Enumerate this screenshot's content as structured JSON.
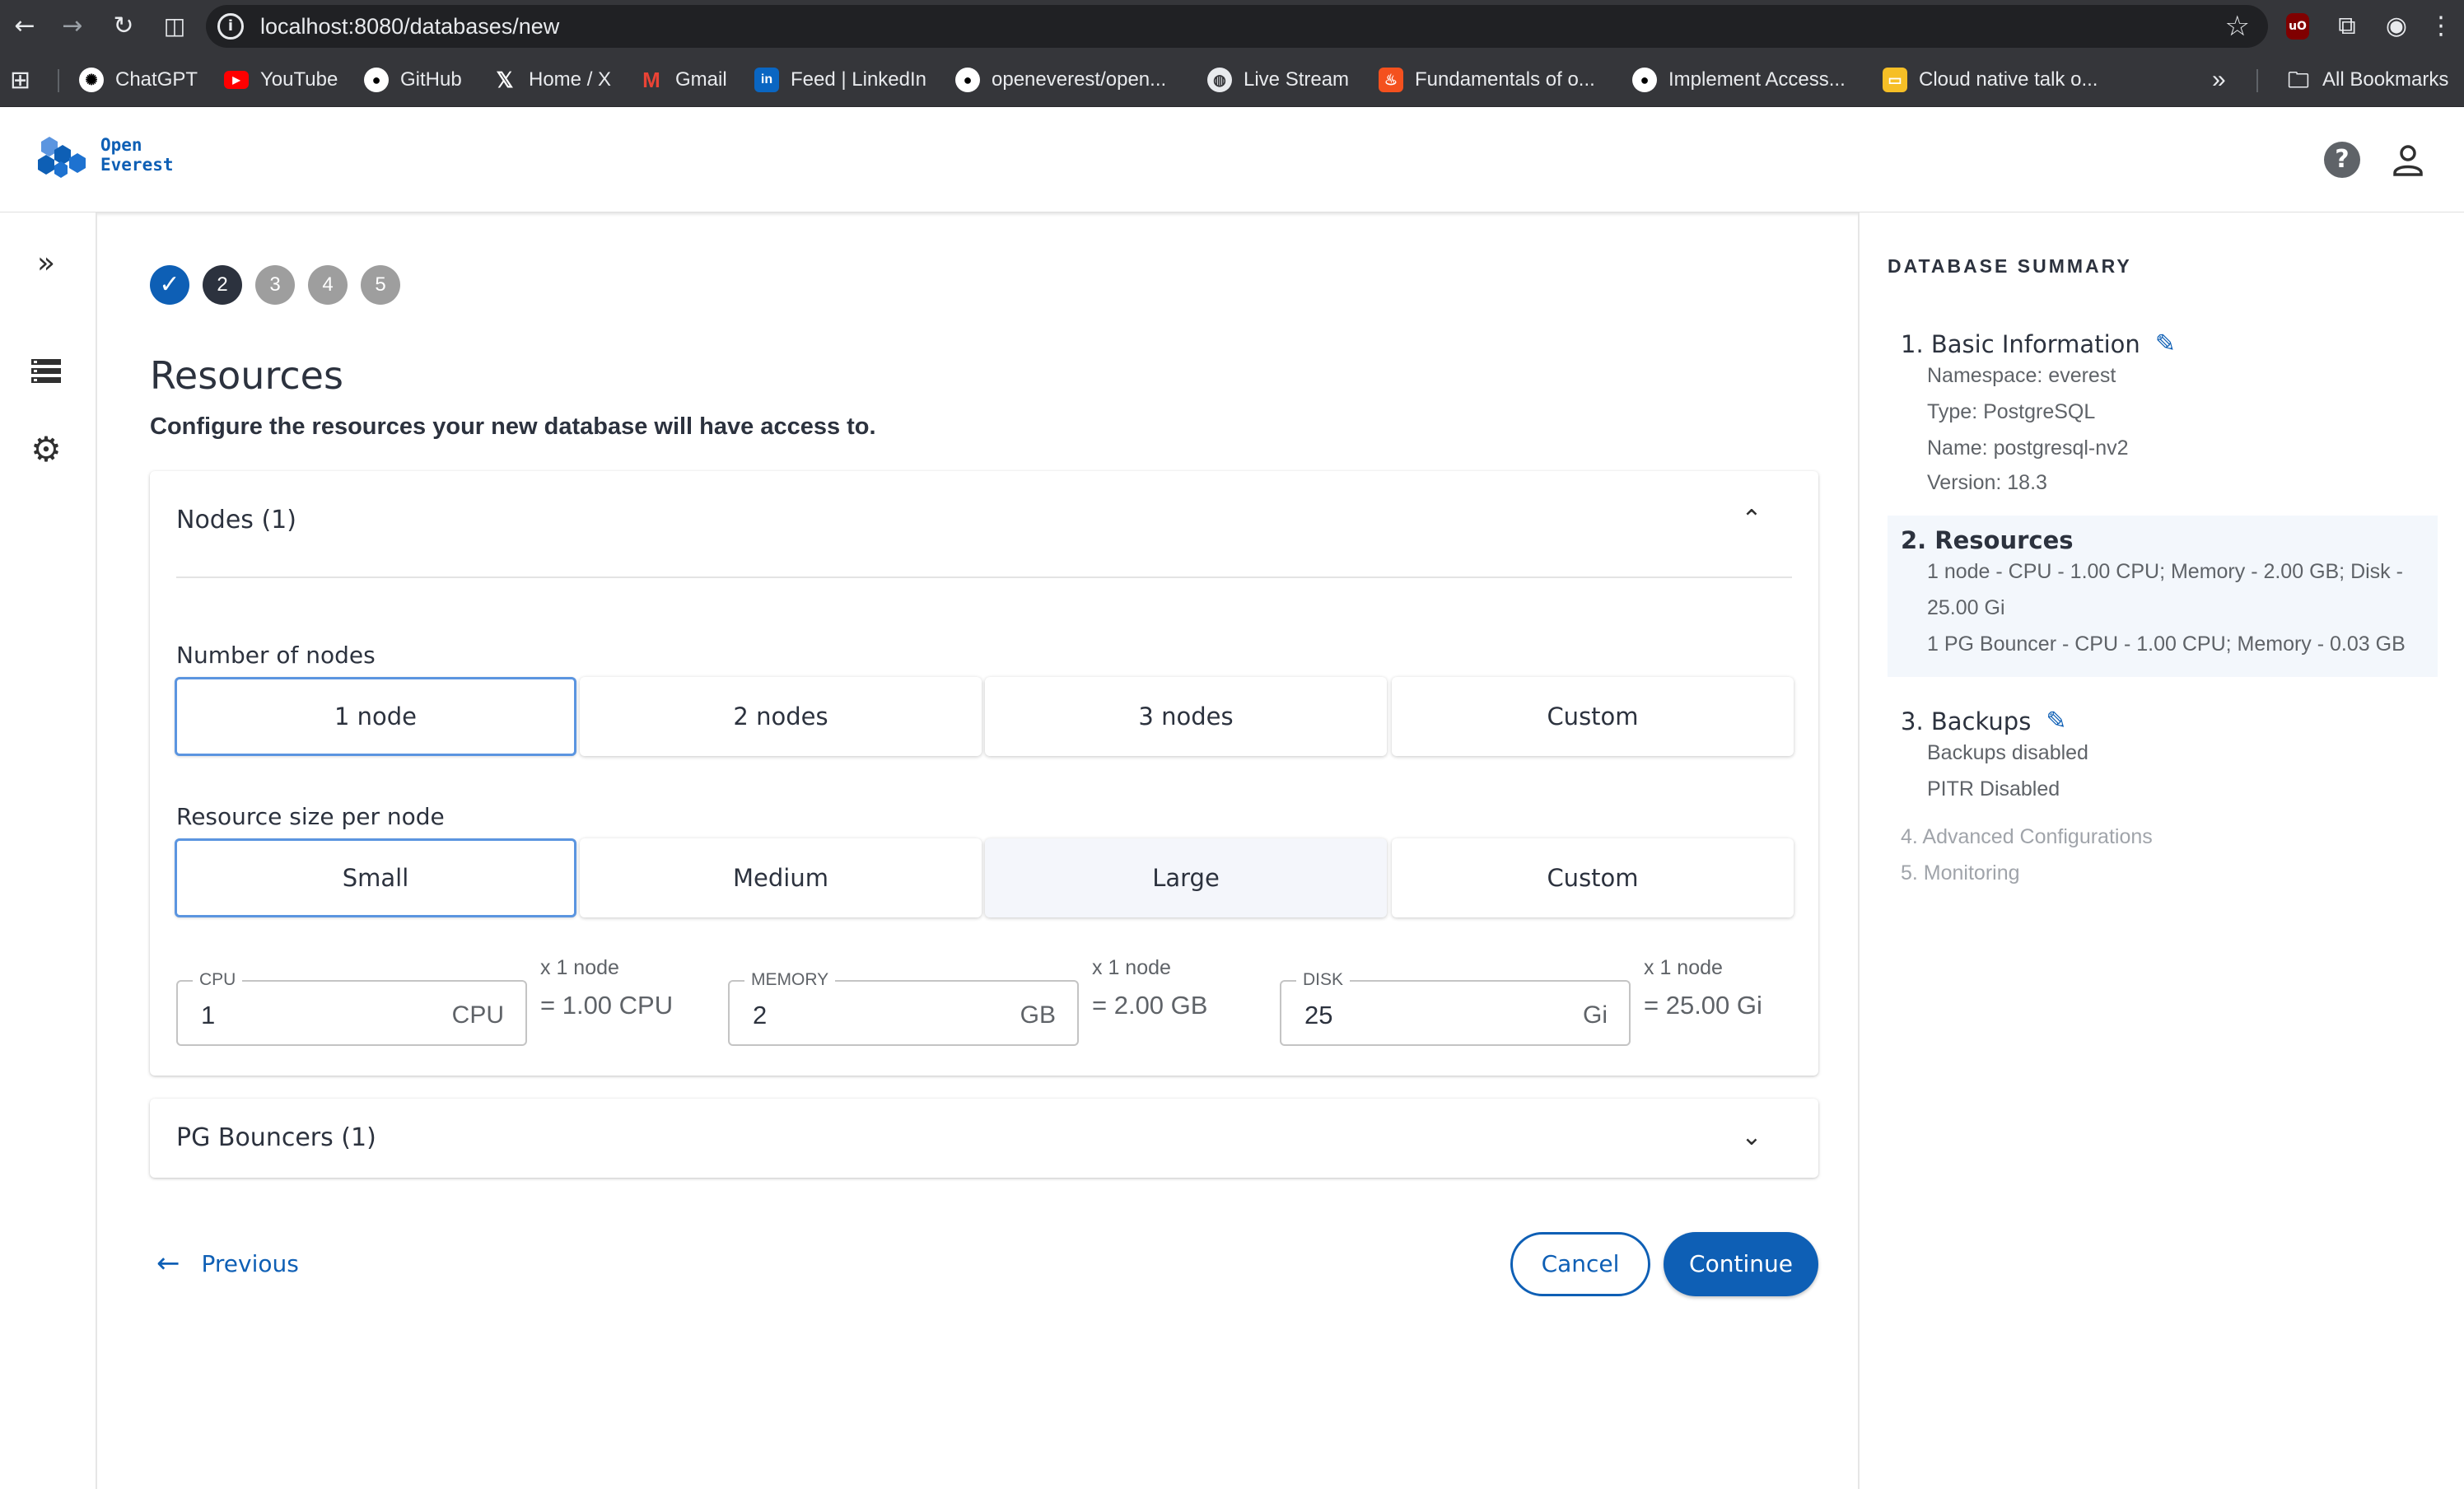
{
  "browser": {
    "url": "localhost:8080/databases/new",
    "bookmarks": [
      {
        "label": "ChatGPT",
        "icon": "chatgpt-icon"
      },
      {
        "label": "YouTube",
        "icon": "youtube-icon"
      },
      {
        "label": "GitHub",
        "icon": "github-icon"
      },
      {
        "label": "Home / X",
        "icon": "x-icon"
      },
      {
        "label": "Gmail",
        "icon": "gmail-icon"
      },
      {
        "label": "Feed | LinkedIn",
        "icon": "linkedin-icon"
      },
      {
        "label": "openeverest/open...",
        "icon": "github-icon"
      },
      {
        "label": "Live Stream",
        "icon": "globe-icon"
      },
      {
        "label": "Fundamentals of o...",
        "icon": "flame-icon"
      },
      {
        "label": "Implement Access...",
        "icon": "github-icon"
      },
      {
        "label": "Cloud native talk o...",
        "icon": "slides-icon"
      }
    ],
    "all_bookmarks": "All Bookmarks",
    "ublock_label": "uO"
  },
  "header": {
    "logo_line1": "Open",
    "logo_line2": "Everest"
  },
  "stepper": {
    "steps": [
      "✓",
      "2",
      "3",
      "4",
      "5"
    ],
    "current": 2
  },
  "main": {
    "title": "Resources",
    "subtitle": "Configure the resources your new database will have access to.",
    "nodes_section": {
      "title": "Nodes (1)",
      "number_label": "Number of nodes",
      "node_options": [
        "1 node",
        "2 nodes",
        "3 nodes",
        "Custom"
      ],
      "selected_node_option": "1 node",
      "size_label": "Resource size per node",
      "size_options": [
        "Small",
        "Medium",
        "Large",
        "Custom"
      ],
      "selected_size_option": "Small",
      "cpu": {
        "label": "CPU",
        "value": "1",
        "unit": "CPU",
        "multiplier": "x 1 node",
        "total": "= 1.00 CPU"
      },
      "memory": {
        "label": "MEMORY",
        "value": "2",
        "unit": "GB",
        "multiplier": "x 1 node",
        "total": "= 2.00 GB"
      },
      "disk": {
        "label": "DISK",
        "value": "25",
        "unit": "Gi",
        "multiplier": "x 1 node",
        "total": "= 25.00 Gi"
      }
    },
    "pgbouncers_section": {
      "title": "PG Bouncers (1)"
    }
  },
  "actions": {
    "previous": "Previous",
    "cancel": "Cancel",
    "continue": "Continue"
  },
  "summary": {
    "heading": "DATABASE SUMMARY",
    "basic": {
      "title": "1. Basic Information",
      "lines": [
        "Namespace: everest",
        "Type: PostgreSQL",
        "Name: postgresql-nv2",
        "Version: 18.3"
      ]
    },
    "resources": {
      "title": "2. Resources",
      "lines": [
        "1 node - CPU - 1.00 CPU; Memory - 2.00 GB; Disk -",
        "25.00 Gi",
        "1 PG Bouncer - CPU - 1.00 CPU; Memory - 0.03 GB"
      ]
    },
    "backups": {
      "title": "3. Backups",
      "lines": [
        "Backups disabled",
        "PITR Disabled"
      ]
    },
    "advanced": "4. Advanced Configurations",
    "monitoring": "5. Monitoring"
  },
  "colors": {
    "accent": "#0e5fb5",
    "text": "#2c323e",
    "muted": "#5f6368",
    "selected_border": "#5b95e0"
  }
}
